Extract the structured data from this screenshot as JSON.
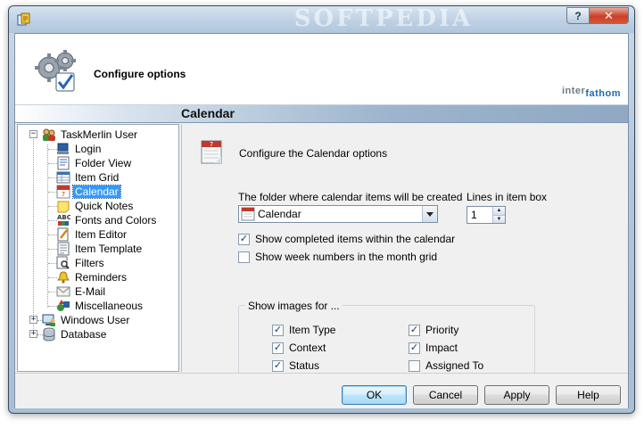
{
  "window": {
    "title_watermark": "SOFTPEDIA",
    "help_glyph": "?",
    "close_glyph": "✕"
  },
  "header": {
    "title": "Configure options",
    "brand_part1": "inter",
    "brand_part2": "fathom"
  },
  "section": {
    "title": "Calendar"
  },
  "tree": {
    "root": "TaskMerlin User",
    "items": [
      {
        "label": "Login",
        "icon": "login-icon"
      },
      {
        "label": "Folder View",
        "icon": "folder-view-icon"
      },
      {
        "label": "Item Grid",
        "icon": "item-grid-icon"
      },
      {
        "label": "Calendar",
        "icon": "calendar-icon",
        "selected": true
      },
      {
        "label": "Quick Notes",
        "icon": "quick-notes-icon"
      },
      {
        "label": "Fonts and Colors",
        "icon": "fonts-colors-icon"
      },
      {
        "label": "Item Editor",
        "icon": "item-editor-icon"
      },
      {
        "label": "Item Template",
        "icon": "item-template-icon"
      },
      {
        "label": "Filters",
        "icon": "filters-icon"
      },
      {
        "label": "Reminders",
        "icon": "reminders-icon"
      },
      {
        "label": "E-Mail",
        "icon": "email-icon"
      },
      {
        "label": "Miscellaneous",
        "icon": "miscellaneous-icon"
      }
    ],
    "windows_user": "Windows User",
    "database": "Database",
    "expand_glyph": "+",
    "collapse_glyph": "−"
  },
  "panel": {
    "heading": "Configure the Calendar options",
    "folder_label": "The folder where calendar items will be created",
    "folder_value": "Calendar",
    "lines_label": "Lines in item box",
    "lines_value": "1",
    "show_completed": {
      "label": "Show completed items within the calendar",
      "checked": true
    },
    "show_week_numbers": {
      "label": "Show week numbers in the month grid",
      "checked": false
    },
    "images_group_title": "Show images for ...",
    "images": [
      {
        "label": "Item Type",
        "checked": true
      },
      {
        "label": "Context",
        "checked": true
      },
      {
        "label": "Status",
        "checked": true
      },
      {
        "label": "Priority",
        "checked": true
      },
      {
        "label": "Impact",
        "checked": true
      },
      {
        "label": "Assigned To",
        "checked": false
      }
    ]
  },
  "buttons": {
    "ok": "OK",
    "cancel": "Cancel",
    "apply": "Apply",
    "help": "Help"
  },
  "colors": {
    "selection": "#3399ff",
    "brand_blue": "#1e6ab4"
  }
}
